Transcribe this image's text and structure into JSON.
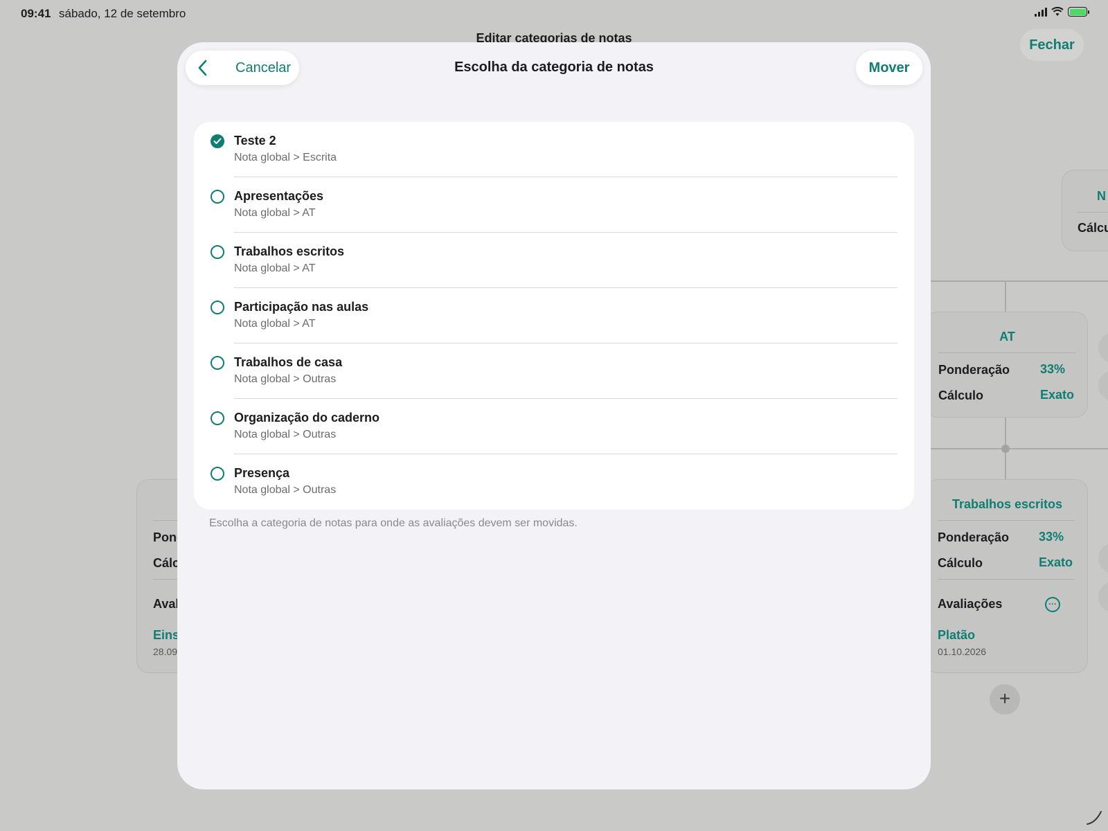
{
  "status_bar": {
    "time": "09:41",
    "date": "sábado, 12 de setembro",
    "icons": [
      "cellular-signal-icon",
      "wifi-icon",
      "battery-charging-icon"
    ]
  },
  "background": {
    "title": "Editar categorias de notas",
    "close_label": "Fechar",
    "card_top_right": {
      "title": "N",
      "row_label": "Cálcu"
    },
    "card_at": {
      "title": "AT",
      "weight_label": "Ponderação",
      "weight_value": "33%",
      "calc_label": "Cálculo",
      "calc_value": "Exato"
    },
    "card_trabalhos": {
      "title": "Trabalhos escritos",
      "weight_label": "Ponderação",
      "weight_value": "33%",
      "calc_label": "Cálculo",
      "calc_value": "Exato",
      "evals_label": "Avaliações",
      "eval_name": "Platão",
      "eval_date": "01.10.2026"
    },
    "card_left": {
      "row1": "Pond",
      "row2": "Cálc",
      "row3": "Aval",
      "eval_name": "Eins",
      "eval_date": "28.09"
    },
    "add_label": "+"
  },
  "modal": {
    "cancel_label": "Cancelar",
    "title": "Escolha da categoria de notas",
    "move_label": "Mover",
    "items": [
      {
        "title": "Teste 2",
        "path": "Nota global > Escrita",
        "selected": true
      },
      {
        "title": "Apresentações",
        "path": "Nota global > AT",
        "selected": false
      },
      {
        "title": "Trabalhos escritos",
        "path": "Nota global > AT",
        "selected": false
      },
      {
        "title": "Participação nas aulas",
        "path": "Nota global > AT",
        "selected": false
      },
      {
        "title": "Trabalhos de casa",
        "path": "Nota global > Outras",
        "selected": false
      },
      {
        "title": "Organização do caderno",
        "path": "Nota global > Outras",
        "selected": false
      },
      {
        "title": "Presença",
        "path": "Nota global > Outras",
        "selected": false
      }
    ],
    "footer_note": "Escolha a categoria de notas para onde as avaliações devem ser movidas."
  },
  "colors": {
    "accent": "#0f7d72",
    "modal_bg": "#f2f2f7",
    "dimmed_bg": "#c9cac8"
  }
}
